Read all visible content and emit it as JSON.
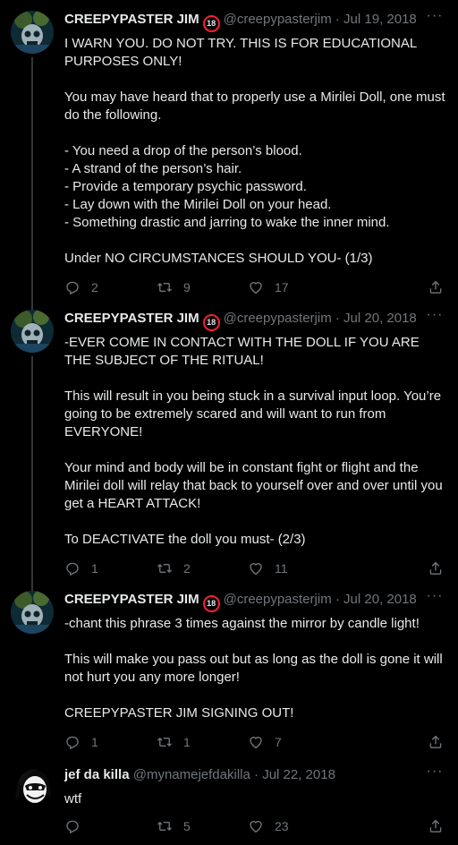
{
  "tweets": [
    {
      "name": "CREEPYPASTER JIM",
      "badge": "18",
      "handle": "@creepypasterjim",
      "date": "Jul 19, 2018",
      "text": "I WARN YOU. DO NOT TRY. THIS IS FOR EDUCATIONAL PURPOSES ONLY!\n\nYou may have heard that to properly use a Mirilei Doll, one must do the following.\n\n- You need a drop of the person’s blood.\n- A strand of the person’s hair.\n- Provide a temporary psychic password.\n- Lay down with the Mirilei Doll on your head.\n- Something drastic and jarring to wake the inner mind.\n\nUnder NO CIRCUMSTANCES SHOULD YOU- (1/3)",
      "replies": "2",
      "retweets": "9",
      "likes": "17"
    },
    {
      "name": "CREEPYPASTER JIM",
      "badge": "18",
      "handle": "@creepypasterjim",
      "date": "Jul 20, 2018",
      "text": "-EVER COME IN CONTACT WITH THE DOLL IF YOU ARE THE SUBJECT OF THE RITUAL!\n\nThis will result in you being stuck in a survival input loop. You’re going to be extremely scared and will want to run from EVERYONE!\n\nYour mind and body will be in constant fight or flight and the Mirilei doll will relay that back to yourself over and over until you get a HEART ATTACK!\n\nTo DEACTIVATE the doll you must- (2/3)",
      "replies": "1",
      "retweets": "2",
      "likes": "11"
    },
    {
      "name": "CREEPYPASTER JIM",
      "badge": "18",
      "handle": "@creepypasterjim",
      "date": "Jul 20, 2018",
      "text": "-chant this phrase 3 times against the mirror by candle light!\n\nThis will make you pass out but as long as the doll is gone it will not hurt you any more longer!\n\nCREEPYPASTER JIM SIGNING OUT!",
      "replies": "1",
      "retweets": "1",
      "likes": "7"
    },
    {
      "name": "jef da killa",
      "handle": "@mynamejefdakilla",
      "date": "Jul 22, 2018",
      "text": "wtf",
      "replies": "",
      "retweets": "5",
      "likes": "23"
    }
  ],
  "separator": "·",
  "more_glyph": "···",
  "colors": {
    "background": "#000000",
    "text": "#e7e9ea",
    "muted": "#71767b",
    "badge_ring": "#f4212e"
  },
  "icons": [
    "reply-icon",
    "retweet-icon",
    "like-icon",
    "share-icon",
    "more-icon"
  ]
}
